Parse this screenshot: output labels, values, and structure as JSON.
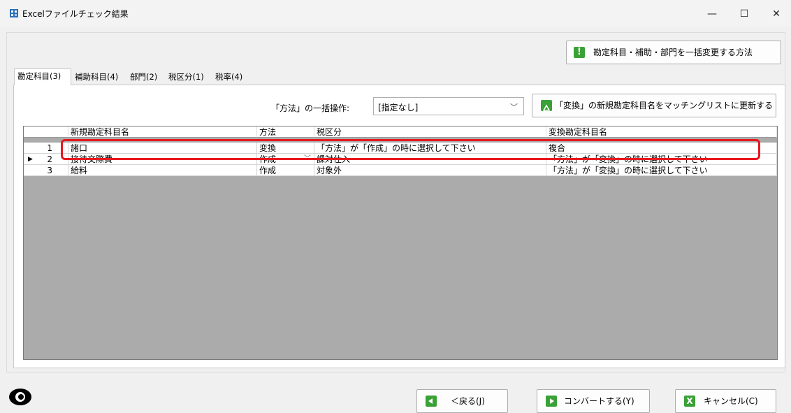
{
  "window": {
    "title": "Excelファイルチェック結果",
    "min": "—",
    "max": "☐",
    "close": "✕"
  },
  "top_button": {
    "label": "勘定科目・補助・部門を一括変更する方法",
    "icon": "exclamation-icon"
  },
  "tabs": [
    {
      "label": "勘定科目(3)",
      "active": true
    },
    {
      "label": "補助科目(4)",
      "active": false
    },
    {
      "label": "部門(2)",
      "active": false
    },
    {
      "label": "税区分(1)",
      "active": false
    },
    {
      "label": "税率(4)",
      "active": false
    }
  ],
  "bulk": {
    "label": "「方法」の一括操作:",
    "selected": "[指定なし]",
    "update_button": "「変換」の新規勘定科目名をマッチングリストに更新する"
  },
  "grid": {
    "columns": [
      "",
      "新規勘定科目名",
      "方法",
      "税区分",
      "変換勘定科目名"
    ],
    "rows": [
      {
        "num": "1",
        "name": "諸口",
        "method": "変換",
        "tax": "「方法」が「作成」の時に選択して下さい",
        "target": "複合"
      },
      {
        "num": "2",
        "name": "接待交際費",
        "method": "作成",
        "tax": "課対仕入",
        "target": "「方法」が「変換」の時に選択して下さい"
      },
      {
        "num": "3",
        "name": "給料",
        "method": "作成",
        "tax": "対象外",
        "target": "「方法」が「変換」の時に選択して下さい"
      }
    ],
    "current_row_marker": "▶"
  },
  "footer": {
    "back": "＜戻る(J)",
    "convert": "コンバートする(Y)",
    "cancel": "キャンセル(C)"
  },
  "colors": {
    "accent_green": "#39a135",
    "highlight_red": "#e8181f",
    "grid_bg": "#ababab"
  }
}
